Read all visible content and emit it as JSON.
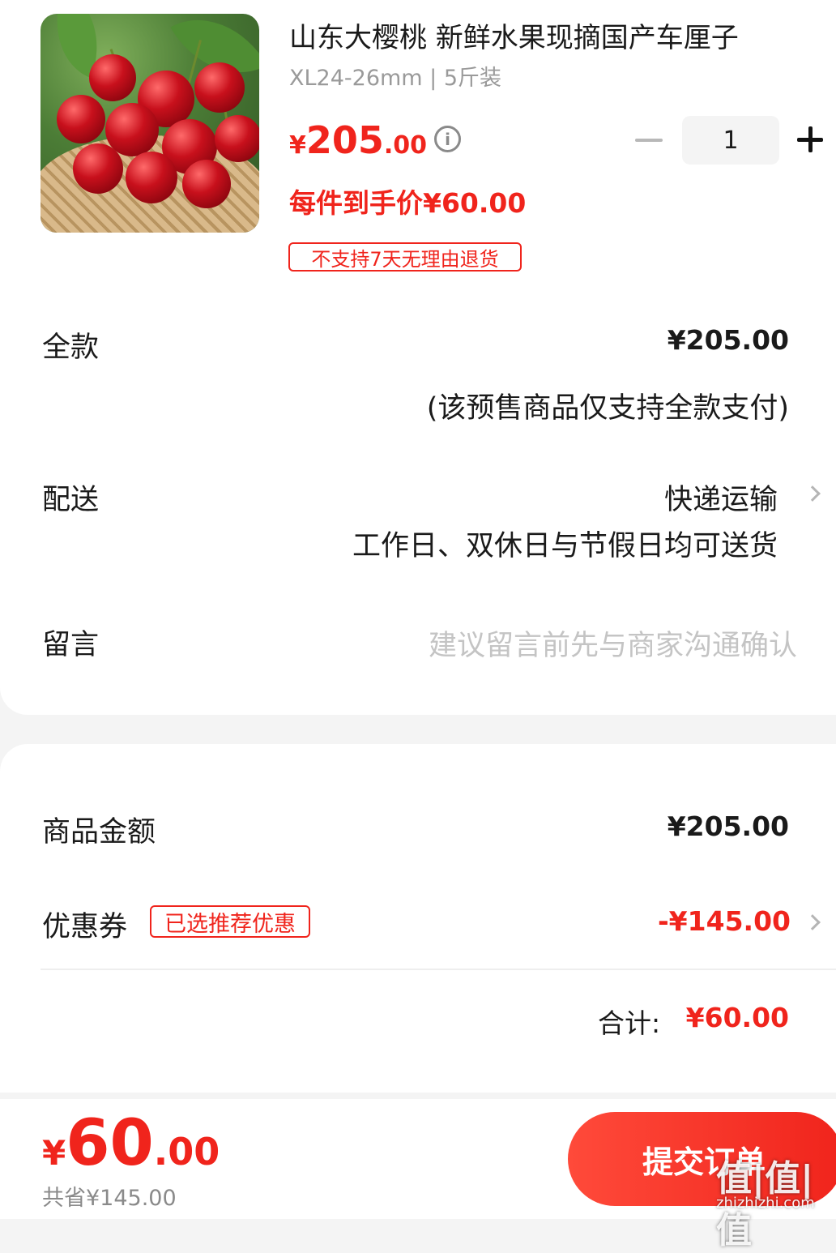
{
  "product": {
    "title": "山东大樱桃 新鲜水果现摘国产车厘子",
    "spec": "XL24-26mm | 5斤装",
    "price_symbol": "¥",
    "price_int": "205",
    "price_dec": ".00",
    "info_icon": "i",
    "quantity": "1",
    "per_item_price": "每件到手价¥60.00",
    "return_tag": "不支持7天无理由退货"
  },
  "payment": {
    "label": "全款",
    "amount": "¥205.00",
    "note": "(该预售商品仅支持全款支付)"
  },
  "delivery": {
    "label": "配送",
    "method": "快递运输",
    "schedule": "工作日、双休日与节假日均可送货"
  },
  "message": {
    "label": "留言",
    "placeholder": "建议留言前先与商家沟通确认"
  },
  "summary": {
    "goods_label": "商品金额",
    "goods_amount": "¥205.00",
    "coupon_label": "优惠券",
    "coupon_tag": "已选推荐优惠",
    "coupon_amount": "-¥145.00",
    "total_label": "合计:",
    "total_amount": "¥60.00"
  },
  "footer": {
    "price_symbol": "¥",
    "price_int": "60",
    "price_dec": ".00",
    "saved": "共省¥145.00",
    "submit_label": "提交订单",
    "watermark": "值|值|值",
    "watermark_domain": "zhizhizhi.com"
  },
  "colors": {
    "accent": "#f0241c",
    "muted": "#9a9a9a"
  }
}
